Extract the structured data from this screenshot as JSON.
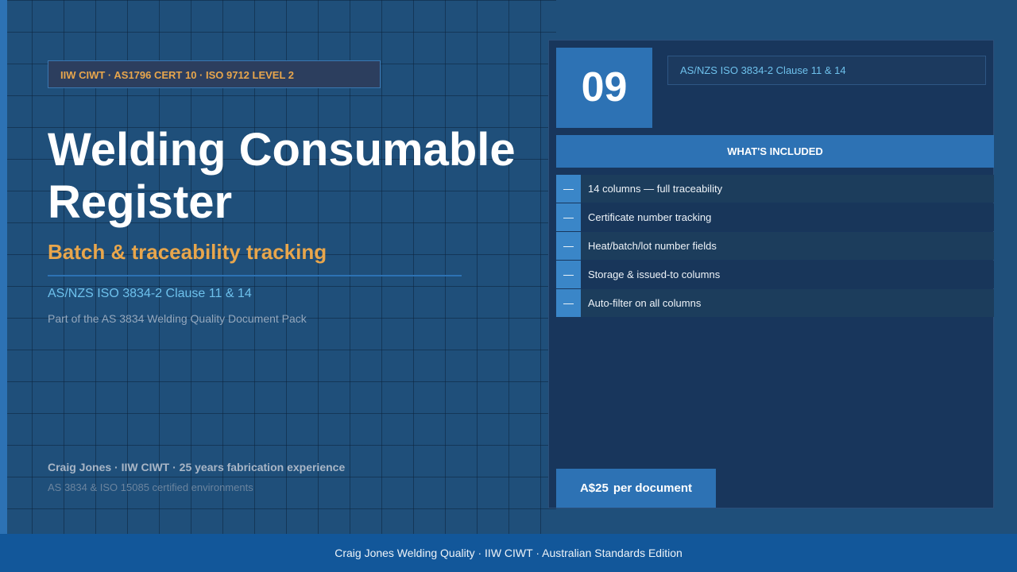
{
  "hero": {
    "badge": "IIW CIWT  ·  AS1796 CERT 10  ·  ISO 9712 LEVEL 2",
    "title": "Welding Consumable Register",
    "subtitle": "Batch & traceability tracking",
    "standard": "AS/NZS ISO 3834-2 Clause 11 & 14",
    "pack_note": "Part of the AS 3834 Welding Quality Document Pack",
    "author": "Craig Jones  ·  IIW CIWT  ·  25 years fabrication experience",
    "environments": "AS 3834 & ISO 15085 certified environments"
  },
  "panel": {
    "doc_number": "09",
    "doc_standard": "AS/NZS ISO 3834-2 Clause 11 & 14",
    "included_header": "WHAT'S INCLUDED",
    "dash_symbol": "—",
    "features": [
      "14 columns — full traceability",
      "Certificate number tracking",
      "Heat/batch/lot number fields",
      "Storage & issued-to columns",
      "Auto-filter on all columns"
    ],
    "price": {
      "amount": "A$25",
      "unit": "per document"
    }
  },
  "footer": {
    "text": "Craig Jones Welding Quality  ·  IIW CIWT  ·  Australian Standards Edition"
  },
  "colors": {
    "background": "#1f4f7a",
    "accent_blue": "#2d72b4",
    "accent_orange": "#e8a64c",
    "link_cyan": "#6ec1ec",
    "panel": "#18365c",
    "footer": "#12579a"
  }
}
